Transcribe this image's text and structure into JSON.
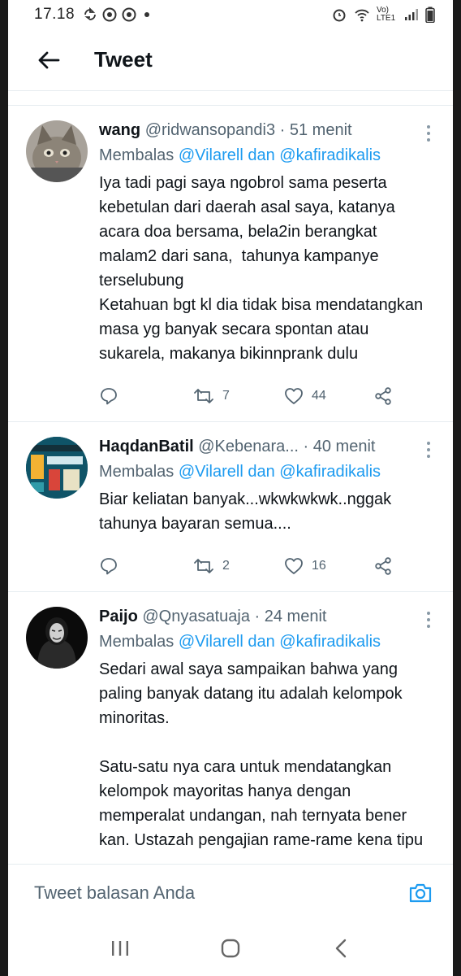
{
  "statusbar": {
    "time": "17.18",
    "network": "Vo) LTE1"
  },
  "header": {
    "title": "Tweet"
  },
  "tweets": [
    {
      "name": "wang",
      "handle": "@ridwansopandi3",
      "sep": " · ",
      "time": "51 menit",
      "reply_prefix": "Membalas ",
      "mention1": "@Vilarell",
      "reply_and": " dan ",
      "mention2": "@kafiradikalis",
      "body": "Iya tadi pagi saya ngobrol sama peserta kebetulan dari daerah asal saya, katanya acara doa bersama, bela2in berangkat malam2 dari sana,  tahunya kampanye terselubung\nKetahuan bgt kl dia tidak bisa mendatangkan masa yg banyak secara spontan atau sukarela, makanya bikinnprank dulu",
      "retweets": "7",
      "likes": "44"
    },
    {
      "name": "HaqdanBatil",
      "handle": "@Kebenara...",
      "sep": " · ",
      "time": "40 menit",
      "reply_prefix": "Membalas ",
      "mention1": "@Vilarell",
      "reply_and": " dan ",
      "mention2": "@kafiradikalis",
      "body": "Biar keliatan banyak...wkwkwkwk..nggak tahunya bayaran semua....",
      "retweets": "2",
      "likes": "16",
      "avatar_text": "3 Tiga perkara yang paling"
    },
    {
      "name": "Paijo",
      "handle": "@Qnyasatuaja",
      "sep": " · ",
      "time": "24 menit",
      "reply_prefix": "Membalas ",
      "mention1": "@Vilarell",
      "reply_and": " dan ",
      "mention2": "@kafiradikalis",
      "body": "Sedari awal saya sampaikan bahwa yang paling banyak datang itu adalah kelompok minoritas.\n\nSatu-satu nya cara untuk mendatangkan kelompok mayoritas hanya dengan memperalat undangan, nah ternyata bener kan. Ustazah pengajian rame-rame kena tipu"
    }
  ],
  "composer": {
    "placeholder": "Tweet balasan Anda"
  },
  "colors": {
    "accent": "#1d9bf0",
    "text": "#0f1419",
    "muted": "#536471"
  },
  "icons": [
    "back-arrow-icon",
    "more-icon",
    "reply-icon",
    "retweet-icon",
    "like-icon",
    "share-icon",
    "camera-icon",
    "recents-icon",
    "home-icon",
    "back-icon"
  ]
}
